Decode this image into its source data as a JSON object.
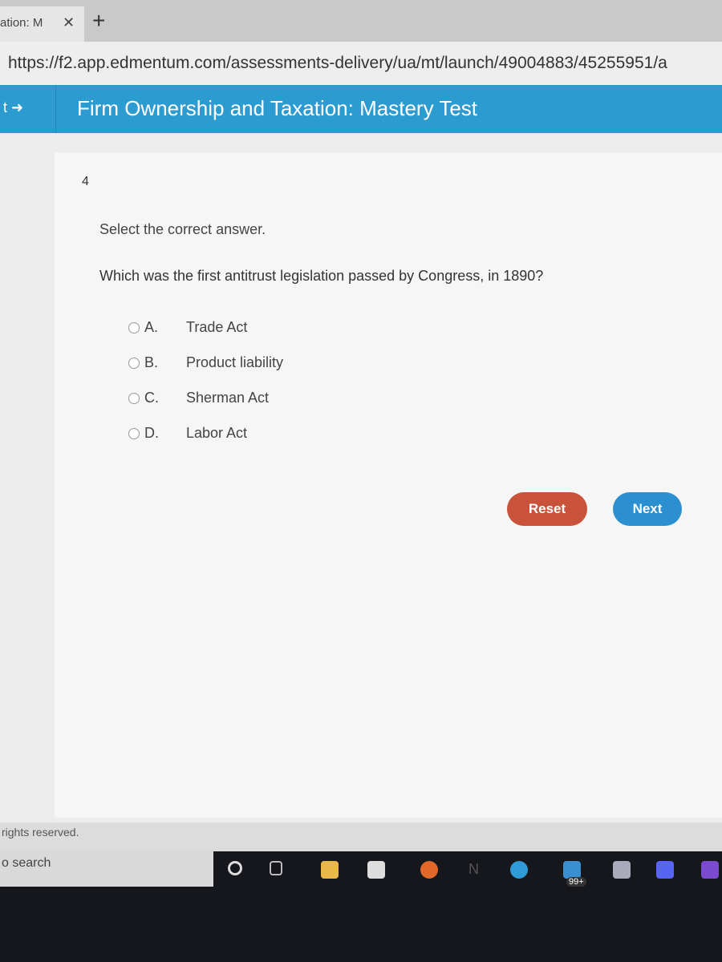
{
  "browser": {
    "tab_title": "ation: M",
    "url": "https://f2.app.edmentum.com/assessments-delivery/ua/mt/launch/49004883/45255951/a"
  },
  "header": {
    "left_label": "t",
    "title": "Firm Ownership and Taxation: Mastery Test"
  },
  "question": {
    "number": "4",
    "instruction": "Select the correct answer.",
    "text": "Which was the first antitrust legislation passed by Congress, in 1890?",
    "options": [
      {
        "letter": "A.",
        "label": "Trade Act"
      },
      {
        "letter": "B.",
        "label": "Product liability"
      },
      {
        "letter": "C.",
        "label": "Sherman Act"
      },
      {
        "letter": "D.",
        "label": "Labor Act"
      }
    ]
  },
  "buttons": {
    "reset": "Reset",
    "next": "Next",
    "reset_color": "#c8533a",
    "next_color": "#2c8fd0"
  },
  "footer": {
    "text": "rights reserved."
  },
  "taskbar": {
    "search": "o search",
    "mail_badge": "99+"
  }
}
